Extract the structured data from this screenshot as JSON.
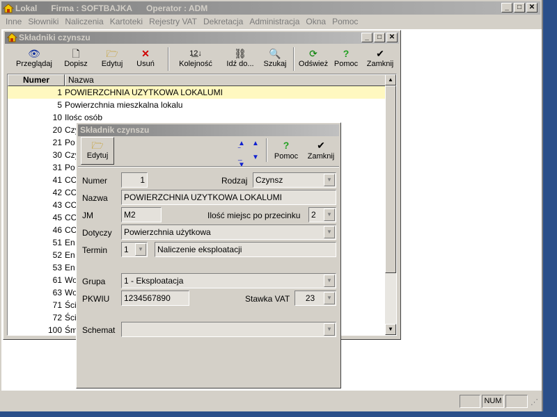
{
  "app": {
    "title": "Lokal",
    "firma": "Firma : SOFTBAJKA",
    "operator": "Operator : ADM"
  },
  "menu": [
    "Inne",
    "Słowniki",
    "Naliczenia",
    "Kartoteki",
    "Rejestry VAT",
    "Dekretacja",
    "Administracja",
    "Okna",
    "Pomoc"
  ],
  "child": {
    "title": "Składniki czynszu",
    "toolbar": {
      "przegladaj": "Przeglądaj",
      "dopisz": "Dopisz",
      "edytuj": "Edytuj",
      "usun": "Usuń",
      "kolejnosc": "Kolejność",
      "idz": "Idź do...",
      "szukaj": "Szukaj",
      "odswiez": "Odśwież",
      "pomoc": "Pomoc",
      "zamknij": "Zamknij"
    },
    "columns": [
      "Numer",
      "Nazwa"
    ],
    "rows": [
      {
        "num": "1",
        "name": "POWIERZCHNIA UZYTKOWA LOKALUMI"
      },
      {
        "num": "5",
        "name": "Powierzchnia mieszkalna lokalu"
      },
      {
        "num": "10",
        "name": "Ilośc osób"
      },
      {
        "num": "20",
        "name": "Czy"
      },
      {
        "num": "21",
        "name": "Po"
      },
      {
        "num": "30",
        "name": "Czy"
      },
      {
        "num": "31",
        "name": "Po"
      },
      {
        "num": "41",
        "name": "CC"
      },
      {
        "num": "42",
        "name": "CC"
      },
      {
        "num": "43",
        "name": "CC"
      },
      {
        "num": "45",
        "name": "CC"
      },
      {
        "num": "46",
        "name": "CC"
      },
      {
        "num": "51",
        "name": "En"
      },
      {
        "num": "52",
        "name": "En"
      },
      {
        "num": "53",
        "name": "En"
      },
      {
        "num": "61",
        "name": "Wo"
      },
      {
        "num": "63",
        "name": "Wo"
      },
      {
        "num": "71",
        "name": "Ści"
      },
      {
        "num": "72",
        "name": "Ści"
      },
      {
        "num": "100",
        "name": "Śm"
      }
    ]
  },
  "dialog": {
    "title": "Składnik czynszu",
    "edytuj": "Edytuj",
    "pomoc": "Pomoc",
    "zamknij": "Zamknij",
    "numer_label": "Numer",
    "numer": "1",
    "rodzaj_label": "Rodzaj",
    "rodzaj": "Czynsz",
    "nazwa_label": "Nazwa",
    "nazwa": "POWIERZCHNIA UZYTKOWA LOKALUMI",
    "jm_label": "JM",
    "jm": "M2",
    "miejsc_label": "Ilość miejsc po przecinku",
    "miejsc": "2",
    "dotyczy_label": "Dotyczy",
    "dotyczy": "Powierzchnia użytkowa",
    "termin_label": "Termin",
    "termin": "1",
    "termin_desc": "Naliczenie eksploatacji",
    "grupa_label": "Grupa",
    "grupa": "1 - Eksploatacja",
    "pkwiu_label": "PKWIU",
    "pkwiu": "1234567890",
    "stawka_label": "Stawka VAT",
    "stawka": "23",
    "schemat_label": "Schemat",
    "schemat": ""
  },
  "status": {
    "num": "NUM"
  },
  "colors": {
    "selected_row": "#fff8c0",
    "desktop": "#2a4f8a"
  }
}
